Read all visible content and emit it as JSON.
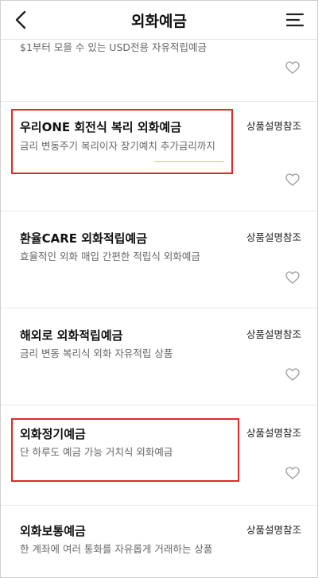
{
  "header": {
    "title": "외화예금",
    "back_icon": "chevron-left-icon",
    "menu_icon": "menu-lines-icon"
  },
  "products": [
    {
      "name": "",
      "description": "$1부터 모을 수 있는 USD전용 자유적립예금",
      "side_label": ""
    },
    {
      "name": "우리ONE 회전식 복리 외화예금",
      "description": "금리 변동주기 복리이자 장기예치 추가금리까지",
      "side_label": "상품설명참조"
    },
    {
      "name": "환율CARE 외화적립예금",
      "description": "효율적인 외화 매입 간편한 적립식 외화예금",
      "side_label": "상품설명참조"
    },
    {
      "name": "해외로 외화적립예금",
      "description": "금리 변동 복리식 외화 자유적립 상품",
      "side_label": "상품설명참조"
    },
    {
      "name": "외화정기예금",
      "description": "단 하루도 예금 가능 거치식 외화예금",
      "side_label": "상품설명참조"
    },
    {
      "name": "외화보통예금",
      "description": "한 계좌에 여러 통화를 자유롭게 거래하는 상품",
      "side_label": "상품설명참조"
    }
  ],
  "colors": {
    "highlight_border": "#e02a2a",
    "heart_stroke": "#9a9a9a"
  }
}
